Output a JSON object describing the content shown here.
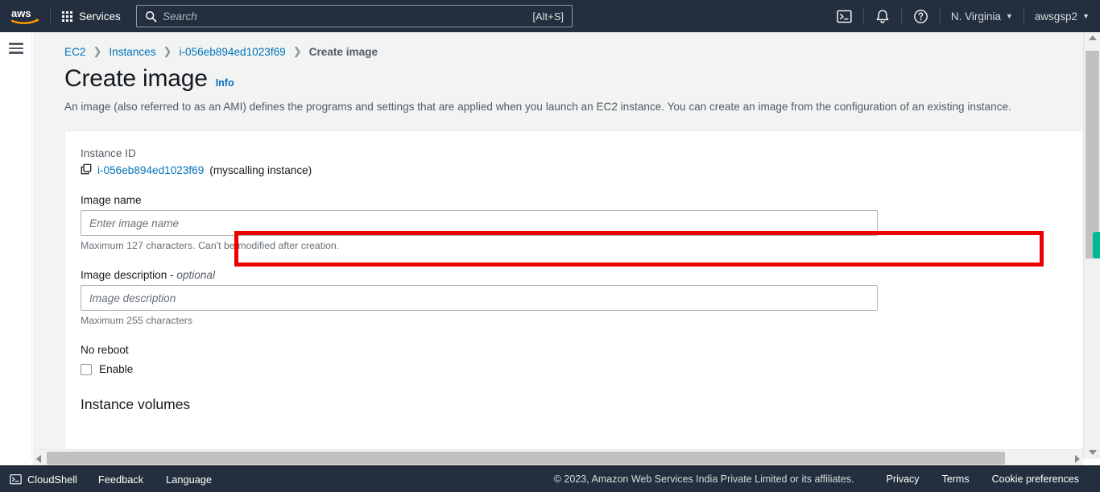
{
  "topnav": {
    "logo_alt": "aws",
    "services_label": "Services",
    "search": {
      "placeholder": "Search",
      "value": "",
      "shortcut_hint": "[Alt+S]"
    },
    "cloudshell_icon": "terminal-icon",
    "notifications_icon": "bell-icon",
    "help_icon": "question-circle-icon",
    "region_label": "N. Virginia",
    "account_label": "awsgsp2",
    "caret": "▼"
  },
  "breadcrumb": {
    "items": [
      {
        "label": "EC2",
        "current": false
      },
      {
        "label": "Instances",
        "current": false
      },
      {
        "label": "i-056eb894ed1023f69",
        "current": false
      },
      {
        "label": "Create image",
        "current": true
      }
    ],
    "separator": "❯"
  },
  "page": {
    "title": "Create image",
    "info_link": "Info",
    "description": "An image (also referred to as an AMI) defines the programs and settings that are applied when you launch an EC2 instance. You can create an image from the configuration of an existing instance."
  },
  "form": {
    "instance_id_label": "Instance ID",
    "instance_id_value": "i-056eb894ed1023f69",
    "instance_alias": "(myscalling instance)",
    "copy_icon": "copy-icon",
    "image_name_label": "Image name",
    "image_name_placeholder": "Enter image name",
    "image_name_value": "",
    "image_name_hint": "Maximum 127 characters. Can't be modified after creation.",
    "image_description_label": "Image description - ",
    "image_description_optional": "optional",
    "image_description_placeholder": "Image description",
    "image_description_value": "",
    "image_description_hint": "Maximum 255 characters",
    "no_reboot_label": "No reboot",
    "no_reboot_checkbox_label": "Enable",
    "no_reboot_checked": false,
    "instance_volumes_heading": "Instance volumes"
  },
  "annotation": {
    "highlight_color": "#ee0000",
    "highlight_target": "image-name-input"
  },
  "footer": {
    "cloudshell_label": "CloudShell",
    "feedback_label": "Feedback",
    "language_label": "Language",
    "copyright": "© 2023, Amazon Web Services India Private Limited or its affiliates.",
    "privacy_label": "Privacy",
    "terms_label": "Terms",
    "cookie_label": "Cookie preferences"
  },
  "scrollbars": {
    "vertical_visible": true,
    "horizontal_visible": true,
    "feedback_tab_color": "#00b894"
  }
}
